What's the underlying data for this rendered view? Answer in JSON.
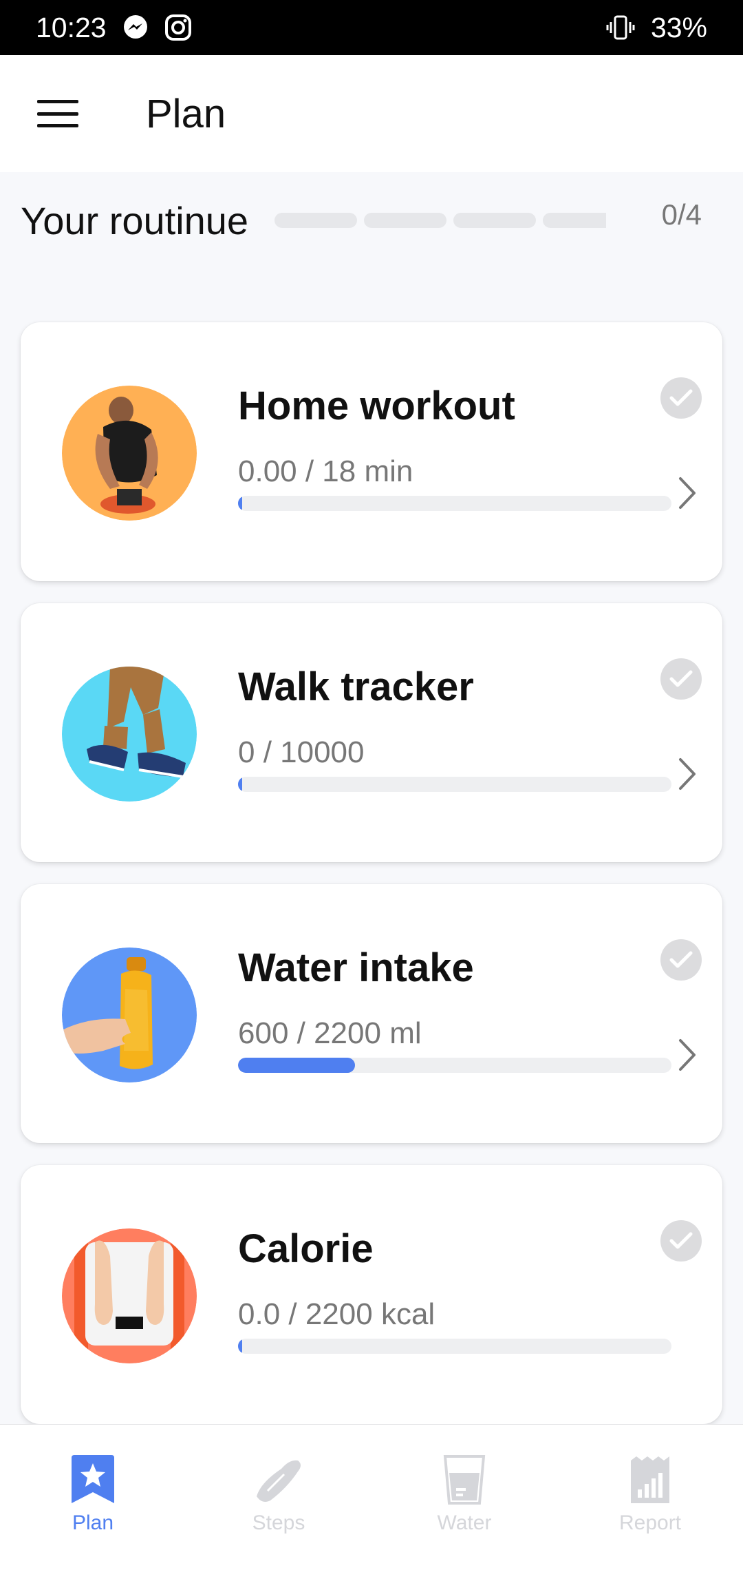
{
  "status_bar": {
    "time": "10:23",
    "battery": "33%"
  },
  "app_bar": {
    "title": "Plan"
  },
  "routine": {
    "title": "Your routinue",
    "progress": "0/4",
    "completed": 0,
    "total": 4
  },
  "cards": [
    {
      "title": "Home workout",
      "value": "0.00 / 18  min",
      "progress": 0.01,
      "thumb_color": "#ffb054",
      "thumb_icon": "workout-man-photo"
    },
    {
      "title": "Walk tracker",
      "value": "0 / 10000",
      "progress": 0.01,
      "thumb_color": "#5ad8f5",
      "thumb_icon": "walking-legs-photo"
    },
    {
      "title": "Water intake",
      "value": "600 / 2200 ml",
      "progress": 0.27,
      "thumb_color": "#5f97f7",
      "thumb_icon": "water-bottle-photo"
    },
    {
      "title": "Calorie",
      "value": "0.0 / 2200 kcal",
      "progress": 0.01,
      "thumb_color": "#ff7e5f",
      "thumb_icon": "scale-feet-photo"
    }
  ],
  "bottom_nav": [
    {
      "label": "Plan",
      "icon": "plan-star-icon",
      "active": true
    },
    {
      "label": "Steps",
      "icon": "shoe-icon",
      "active": false
    },
    {
      "label": "Water",
      "icon": "water-glass-icon",
      "active": false
    },
    {
      "label": "Report",
      "icon": "report-chart-icon",
      "active": false
    }
  ],
  "colors": {
    "accent": "#4f7ff0",
    "inactive_nav": "#d5d6da"
  }
}
